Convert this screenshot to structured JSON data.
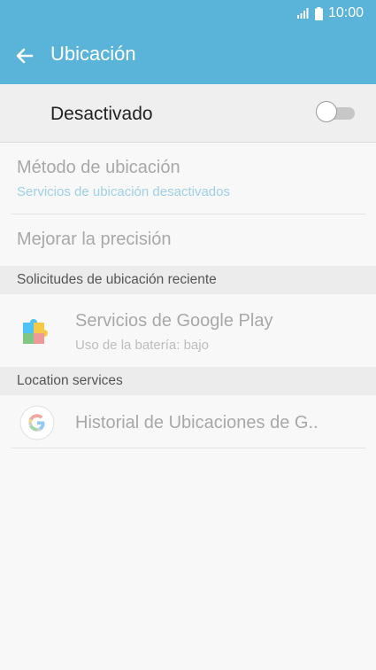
{
  "status_bar": {
    "time": "10:00",
    "signal_icon": "signal-icon",
    "battery_icon": "battery-icon"
  },
  "app_bar": {
    "title": "Ubicación",
    "back_icon": "back-arrow-icon"
  },
  "master_switch": {
    "label": "Desactivado",
    "state": "off"
  },
  "items": {
    "metodo": {
      "title": "Método de ubicación",
      "subtitle": "Servicios de ubicación desactivados",
      "subtitle_color": "#9fd0e6"
    },
    "mejorar": {
      "title": "Mejorar la precisión"
    }
  },
  "sections": {
    "recent": {
      "header": "Solicitudes de ubicación reciente",
      "app": {
        "name": "Servicios de Google Play",
        "detail": "Uso de la batería: bajo",
        "icon": "google-play-services-icon"
      }
    },
    "services": {
      "header": "Location services",
      "app": {
        "name": "Historial de Ubicaciones de G..",
        "icon": "google-g-icon"
      }
    }
  },
  "colors": {
    "accent": "#5ab3d9",
    "disabled_text": "#a8a8a8"
  }
}
